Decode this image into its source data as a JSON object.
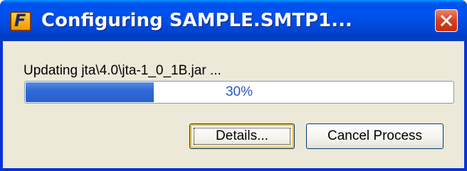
{
  "window": {
    "title": "Configuring SAMPLE.SMTP1...",
    "app_icon": "app-logo-icon",
    "app_icon_glyph": "F",
    "close_icon": "close-icon"
  },
  "status": {
    "message": "Updating jta\\4.0\\jta-1_0_1B.jar ..."
  },
  "progress": {
    "percent": 30,
    "label": "30%"
  },
  "buttons": {
    "details_label": "Details...",
    "cancel_label": "Cancel Process"
  },
  "colors": {
    "titlebar": "#0054e3",
    "client_bg": "#ece9d8",
    "progress_fill": "#2f6ad8",
    "progress_text": "#2a56c6",
    "close_button": "#d6401f"
  }
}
